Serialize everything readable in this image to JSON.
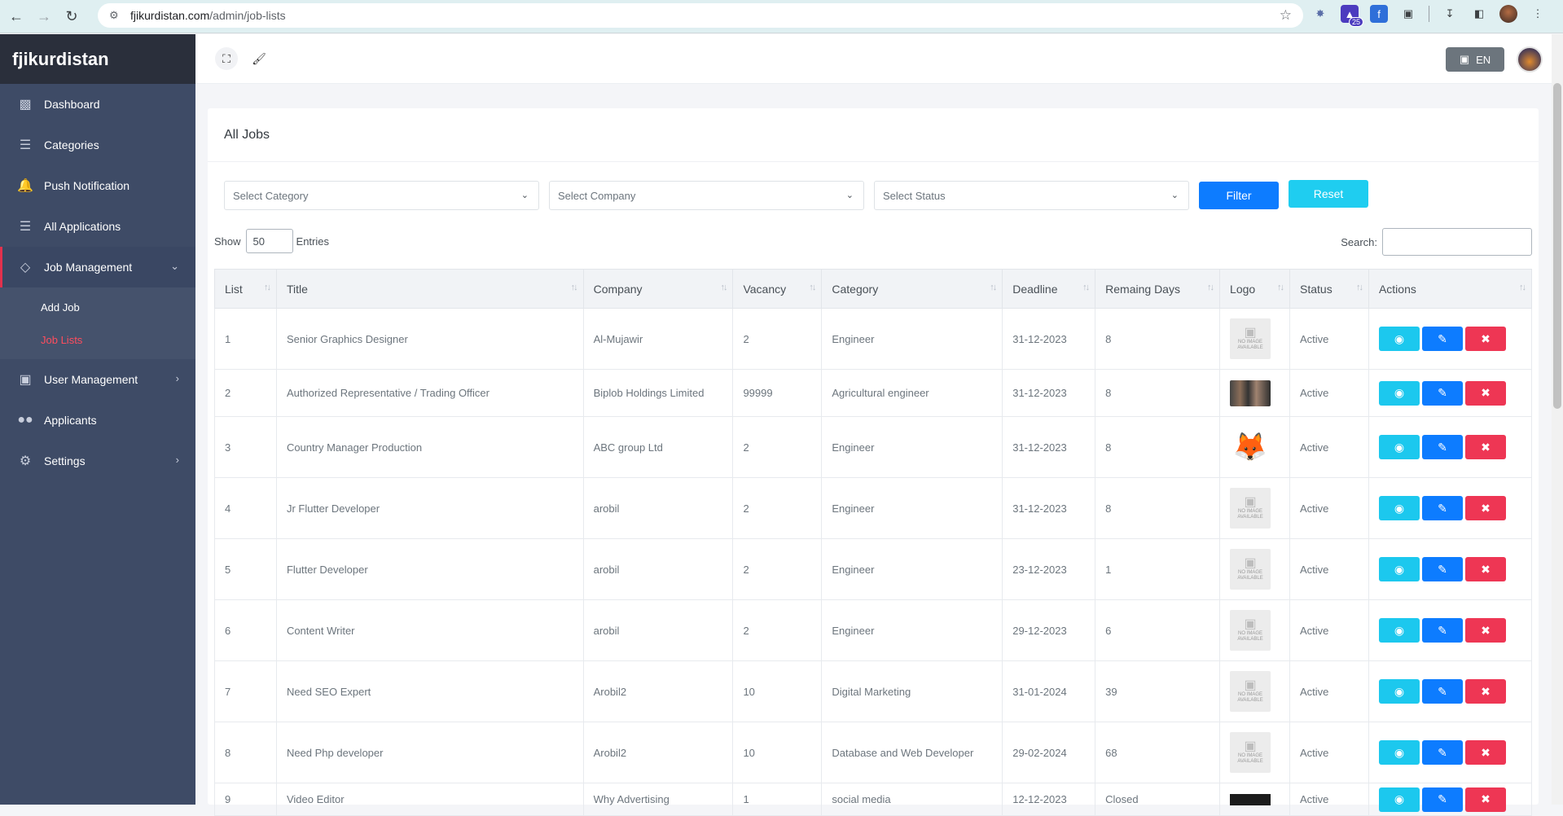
{
  "browser": {
    "url_host": "fjikurdistan.com",
    "url_path": "/admin/job-lists",
    "extension_badge": "25"
  },
  "sidebar": {
    "brand": "fjikurdistan",
    "items": [
      {
        "label": "Dashboard",
        "icon": "bar-chart-icon"
      },
      {
        "label": "Categories",
        "icon": "list-icon"
      },
      {
        "label": "Push Notification",
        "icon": "bell-icon"
      },
      {
        "label": "All Applications",
        "icon": "list-icon"
      },
      {
        "label": "Job Management",
        "icon": "layers-icon"
      },
      {
        "label": "User Management",
        "icon": "book-icon"
      },
      {
        "label": "Applicants",
        "icon": "users-icon"
      },
      {
        "label": "Settings",
        "icon": "gear-icon"
      }
    ],
    "job_submenu": [
      "Add Job",
      "Job Lists"
    ]
  },
  "topbar": {
    "language": "EN"
  },
  "card": {
    "title": "All Jobs",
    "filters": {
      "category_placeholder": "Select Category",
      "company_placeholder": "Select Company",
      "status_placeholder": "Select Status",
      "filter_label": "Filter",
      "reset_label": "Reset"
    },
    "show_label": "Show",
    "entries_value": "50",
    "entries_label": "Entries",
    "search_label": "Search:"
  },
  "table": {
    "headers": [
      "List",
      "Title",
      "Company",
      "Vacancy",
      "Category",
      "Deadline",
      "Remaing Days",
      "Logo",
      "Status",
      "Actions"
    ],
    "rows": [
      {
        "list": "1",
        "title": "Senior Graphics Designer",
        "company": "Al-Mujawir",
        "vacancy": "2",
        "category": "Engineer",
        "deadline": "31-12-2023",
        "days": "8",
        "logo": "no-image",
        "status": "Active"
      },
      {
        "list": "2",
        "title": "Authorized Representative / Trading Officer",
        "company": "Biplob Holdings Limited",
        "vacancy": "99999",
        "category": "Agricultural engineer",
        "deadline": "31-12-2023",
        "days": "8",
        "logo": "people",
        "status": "Active"
      },
      {
        "list": "3",
        "title": "Country Manager Production",
        "company": "ABC group Ltd",
        "vacancy": "2",
        "category": "Engineer",
        "deadline": "31-12-2023",
        "days": "8",
        "logo": "fox",
        "status": "Active"
      },
      {
        "list": "4",
        "title": "Jr Flutter Developer",
        "company": "arobil",
        "vacancy": "2",
        "category": "Engineer",
        "deadline": "31-12-2023",
        "days": "8",
        "logo": "no-image",
        "status": "Active"
      },
      {
        "list": "5",
        "title": "Flutter Developer",
        "company": "arobil",
        "vacancy": "2",
        "category": "Engineer",
        "deadline": "23-12-2023",
        "days": "1",
        "logo": "no-image",
        "status": "Active"
      },
      {
        "list": "6",
        "title": "Content Writer",
        "company": "arobil",
        "vacancy": "2",
        "category": "Engineer",
        "deadline": "29-12-2023",
        "days": "6",
        "logo": "no-image",
        "status": "Active"
      },
      {
        "list": "7",
        "title": "Need SEO Expert",
        "company": "Arobil2",
        "vacancy": "10",
        "category": "Digital Marketing",
        "deadline": "31-01-2024",
        "days": "39",
        "logo": "no-image",
        "status": "Active"
      },
      {
        "list": "8",
        "title": "Need Php developer",
        "company": "Arobil2",
        "vacancy": "10",
        "category": "Database and Web Developer",
        "deadline": "29-02-2024",
        "days": "68",
        "logo": "no-image",
        "status": "Active"
      },
      {
        "list": "9",
        "title": "Video Editor",
        "company": "Why Advertising",
        "vacancy": "1",
        "category": "social media",
        "deadline": "12-12-2023",
        "days": "Closed",
        "logo": "dark",
        "status": "Active"
      }
    ],
    "no_image_text": "NO IMAGE AVAILABLE"
  },
  "colors": {
    "sidebar_bg": "#3e4b66",
    "brand_bg": "#2a2f3b",
    "active_accent": "#e2314d",
    "filter_btn": "#0d7cff",
    "reset_btn": "#1fcdf0",
    "view_btn": "#1cc8ee",
    "edit_btn": "#0d7cff",
    "delete_btn": "#ee3654",
    "closed_text": "#ff3b4e"
  }
}
